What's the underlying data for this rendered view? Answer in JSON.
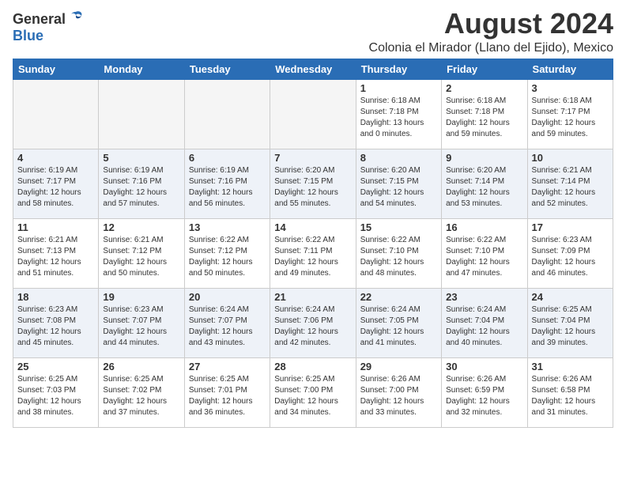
{
  "header": {
    "logo_general": "General",
    "logo_blue": "Blue",
    "month_title": "August 2024",
    "location": "Colonia el Mirador (Llano del Ejido), Mexico"
  },
  "days_of_week": [
    "Sunday",
    "Monday",
    "Tuesday",
    "Wednesday",
    "Thursday",
    "Friday",
    "Saturday"
  ],
  "weeks": [
    {
      "row_class": "row-odd",
      "days": [
        {
          "num": "",
          "info": "",
          "empty": true
        },
        {
          "num": "",
          "info": "",
          "empty": true
        },
        {
          "num": "",
          "info": "",
          "empty": true
        },
        {
          "num": "",
          "info": "",
          "empty": true
        },
        {
          "num": "1",
          "info": "Sunrise: 6:18 AM\nSunset: 7:18 PM\nDaylight: 13 hours\nand 0 minutes.",
          "empty": false
        },
        {
          "num": "2",
          "info": "Sunrise: 6:18 AM\nSunset: 7:18 PM\nDaylight: 12 hours\nand 59 minutes.",
          "empty": false
        },
        {
          "num": "3",
          "info": "Sunrise: 6:18 AM\nSunset: 7:17 PM\nDaylight: 12 hours\nand 59 minutes.",
          "empty": false
        }
      ]
    },
    {
      "row_class": "row-even",
      "days": [
        {
          "num": "4",
          "info": "Sunrise: 6:19 AM\nSunset: 7:17 PM\nDaylight: 12 hours\nand 58 minutes.",
          "empty": false
        },
        {
          "num": "5",
          "info": "Sunrise: 6:19 AM\nSunset: 7:16 PM\nDaylight: 12 hours\nand 57 minutes.",
          "empty": false
        },
        {
          "num": "6",
          "info": "Sunrise: 6:19 AM\nSunset: 7:16 PM\nDaylight: 12 hours\nand 56 minutes.",
          "empty": false
        },
        {
          "num": "7",
          "info": "Sunrise: 6:20 AM\nSunset: 7:15 PM\nDaylight: 12 hours\nand 55 minutes.",
          "empty": false
        },
        {
          "num": "8",
          "info": "Sunrise: 6:20 AM\nSunset: 7:15 PM\nDaylight: 12 hours\nand 54 minutes.",
          "empty": false
        },
        {
          "num": "9",
          "info": "Sunrise: 6:20 AM\nSunset: 7:14 PM\nDaylight: 12 hours\nand 53 minutes.",
          "empty": false
        },
        {
          "num": "10",
          "info": "Sunrise: 6:21 AM\nSunset: 7:14 PM\nDaylight: 12 hours\nand 52 minutes.",
          "empty": false
        }
      ]
    },
    {
      "row_class": "row-odd",
      "days": [
        {
          "num": "11",
          "info": "Sunrise: 6:21 AM\nSunset: 7:13 PM\nDaylight: 12 hours\nand 51 minutes.",
          "empty": false
        },
        {
          "num": "12",
          "info": "Sunrise: 6:21 AM\nSunset: 7:12 PM\nDaylight: 12 hours\nand 50 minutes.",
          "empty": false
        },
        {
          "num": "13",
          "info": "Sunrise: 6:22 AM\nSunset: 7:12 PM\nDaylight: 12 hours\nand 50 minutes.",
          "empty": false
        },
        {
          "num": "14",
          "info": "Sunrise: 6:22 AM\nSunset: 7:11 PM\nDaylight: 12 hours\nand 49 minutes.",
          "empty": false
        },
        {
          "num": "15",
          "info": "Sunrise: 6:22 AM\nSunset: 7:10 PM\nDaylight: 12 hours\nand 48 minutes.",
          "empty": false
        },
        {
          "num": "16",
          "info": "Sunrise: 6:22 AM\nSunset: 7:10 PM\nDaylight: 12 hours\nand 47 minutes.",
          "empty": false
        },
        {
          "num": "17",
          "info": "Sunrise: 6:23 AM\nSunset: 7:09 PM\nDaylight: 12 hours\nand 46 minutes.",
          "empty": false
        }
      ]
    },
    {
      "row_class": "row-even",
      "days": [
        {
          "num": "18",
          "info": "Sunrise: 6:23 AM\nSunset: 7:08 PM\nDaylight: 12 hours\nand 45 minutes.",
          "empty": false
        },
        {
          "num": "19",
          "info": "Sunrise: 6:23 AM\nSunset: 7:07 PM\nDaylight: 12 hours\nand 44 minutes.",
          "empty": false
        },
        {
          "num": "20",
          "info": "Sunrise: 6:24 AM\nSunset: 7:07 PM\nDaylight: 12 hours\nand 43 minutes.",
          "empty": false
        },
        {
          "num": "21",
          "info": "Sunrise: 6:24 AM\nSunset: 7:06 PM\nDaylight: 12 hours\nand 42 minutes.",
          "empty": false
        },
        {
          "num": "22",
          "info": "Sunrise: 6:24 AM\nSunset: 7:05 PM\nDaylight: 12 hours\nand 41 minutes.",
          "empty": false
        },
        {
          "num": "23",
          "info": "Sunrise: 6:24 AM\nSunset: 7:04 PM\nDaylight: 12 hours\nand 40 minutes.",
          "empty": false
        },
        {
          "num": "24",
          "info": "Sunrise: 6:25 AM\nSunset: 7:04 PM\nDaylight: 12 hours\nand 39 minutes.",
          "empty": false
        }
      ]
    },
    {
      "row_class": "row-odd",
      "days": [
        {
          "num": "25",
          "info": "Sunrise: 6:25 AM\nSunset: 7:03 PM\nDaylight: 12 hours\nand 38 minutes.",
          "empty": false
        },
        {
          "num": "26",
          "info": "Sunrise: 6:25 AM\nSunset: 7:02 PM\nDaylight: 12 hours\nand 37 minutes.",
          "empty": false
        },
        {
          "num": "27",
          "info": "Sunrise: 6:25 AM\nSunset: 7:01 PM\nDaylight: 12 hours\nand 36 minutes.",
          "empty": false
        },
        {
          "num": "28",
          "info": "Sunrise: 6:25 AM\nSunset: 7:00 PM\nDaylight: 12 hours\nand 34 minutes.",
          "empty": false
        },
        {
          "num": "29",
          "info": "Sunrise: 6:26 AM\nSunset: 7:00 PM\nDaylight: 12 hours\nand 33 minutes.",
          "empty": false
        },
        {
          "num": "30",
          "info": "Sunrise: 6:26 AM\nSunset: 6:59 PM\nDaylight: 12 hours\nand 32 minutes.",
          "empty": false
        },
        {
          "num": "31",
          "info": "Sunrise: 6:26 AM\nSunset: 6:58 PM\nDaylight: 12 hours\nand 31 minutes.",
          "empty": false
        }
      ]
    }
  ]
}
